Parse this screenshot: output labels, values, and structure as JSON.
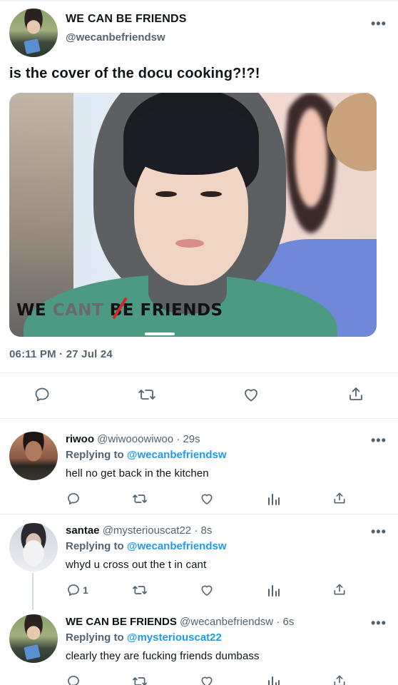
{
  "main_tweet": {
    "display_name": "WE CAN BE FRIENDS",
    "handle": "@wecanbefriendsw",
    "text": "is the cover of the docu cooking?!?!",
    "media": {
      "banner_we": "WE",
      "banner_cant": "CANT",
      "banner_be_friends": "BE FRIENDS"
    },
    "timestamp": "06:11 PM · 27 Jul 24",
    "actions": [
      "reply-icon",
      "retweet-icon",
      "like-icon",
      "share-icon"
    ]
  },
  "replies": [
    {
      "display_name": "riwoo",
      "handle": "@wiwooowiwoo",
      "time": "· 29s",
      "replying_label": "Replying to",
      "replying_to": "@wecanbefriendsw",
      "text": "hell no get back in the kitchen",
      "reply_count": ""
    },
    {
      "display_name": "santae",
      "handle": "@mysteriouscat22",
      "time": "· 8s",
      "replying_label": "Replying to",
      "replying_to": "@wecanbefriendsw",
      "text": "whyd u cross out the t in cant",
      "reply_count": "1"
    },
    {
      "display_name": "WE CAN BE FRIENDS",
      "handle": "@wecanbefriendsw",
      "time": "· 6s",
      "replying_label": "Replying to",
      "replying_to": "@mysteriouscat22",
      "text": "clearly they are fucking friends dumbass",
      "reply_count": ""
    }
  ],
  "more_glyph": "•••",
  "colors": {
    "text": "#0f1419",
    "secondary": "#536471",
    "link": "#1d9bf0",
    "banner_strike": "#d3272b"
  }
}
